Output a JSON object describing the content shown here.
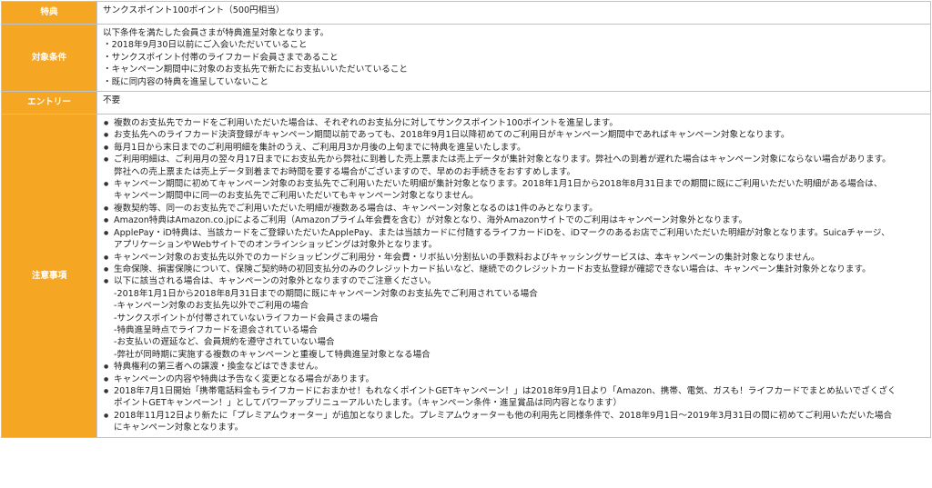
{
  "rows": {
    "benefit": {
      "label": "特典",
      "value": "サンクスポイント100ポイント（500円相当）"
    },
    "conditions": {
      "label": "対象条件",
      "lines": [
        "以下条件を満たした会員さまが特典進呈対象となります。",
        "・2018年9月30日以前にご入会いただいていること",
        "・サンクスポイント付帯のライフカード会員さまであること",
        "・キャンペーン期間中に対象のお支払先で新たにお支払いいただいていること",
        "・既に同内容の特典を進呈していないこと"
      ]
    },
    "entry": {
      "label": "エントリー",
      "value": "不要"
    },
    "notes": {
      "label": "注意事項",
      "items": [
        [
          "複数のお支払先でカードをご利用いただいた場合は、それぞれのお支払分に対してサンクスポイント100ポイントを進呈します。"
        ],
        [
          "お支払先へのライフカード決済登録がキャンペーン期間以前であっても、2018年9月1日以降初めてのご利用日がキャンペーン期間中であればキャンペーン対象となります。"
        ],
        [
          "毎月1日から末日までのご利用明細を集計のうえ、ご利用月3か月後の上旬までに特典を進呈いたします。"
        ],
        [
          "ご利用明細は、ご利用月の翌々月17日までにお支払先から弊社に到着した売上票または売上データが集計対象となります。弊社への到着が遅れた場合はキャンペーン対象にならない場合があります。",
          "弊社への売上票または売上データ到着までお時間を要する場合がございますので、早めのお手続きをおすすめします。"
        ],
        [
          "キャンペーン期間に初めてキャンペーン対象のお支払先でご利用いただいた明細が集計対象となります。2018年1月1日から2018年8月31日までの期間に既にご利用いただいた明細がある場合は、",
          "キャンペーン期間中に同一のお支払先でご利用いただいてもキャンペーン対象となりません。"
        ],
        [
          "複数契約等、同一のお支払先でご利用いただいた明細が複数ある場合は、キャンペーン対象となるのは1件のみとなります。"
        ],
        [
          "Amazon特典はAmazon.co.jpによるご利用（Amazonプライム年会費を含む）が対象となり、海外Amazonサイトでのご利用はキャンペーン対象外となります。"
        ],
        [
          "ApplePay・iD特典は、当該カードをご登録いただいたApplePay、または当該カードに付随するライフカードiDを、iDマークのあるお店でご利用いただいた明細が対象となります。Suicaチャージ、",
          "アプリケーションやWebサイトでのオンラインショッピングは対象外となります。"
        ],
        [
          "キャンペーン対象のお支払先以外でのカードショッピングご利用分・年会費・リボ払い分割払いの手数料およびキャッシングサービスは、本キャンペーンの集計対象となりません。"
        ],
        [
          "生命保険、損害保険について、保険ご契約時の初回支払分のみのクレジットカード払いなど、継続でのクレジットカードお支払登録が確認できない場合は、キャンペーン集計対象外となります。"
        ],
        [
          "以下に該当される場合は、キャンペーンの対象外となりますのでご注意ください。",
          "-2018年1月1日から2018年8月31日までの期間に既にキャンペーン対象のお支払先でご利用されている場合",
          "-キャンペーン対象のお支払先以外でご利用の場合",
          "-サンクスポイントが付帯されていないライフカード会員さまの場合",
          "-特典進呈時点でライフカードを退会されている場合",
          "-お支払いの遅延など、会員規約を遵守されていない場合",
          "-弊社が同時期に実施する複数のキャンペーンと重複して特典進呈対象となる場合"
        ],
        [
          "特典権利の第三者への譲渡・換金などはできません。"
        ],
        [
          "キャンペーンの内容や特典は予告なく変更となる場合があります。"
        ],
        [
          "2018年7月1日開始「携帯電話料金もライフカードにおまかせ！もれなくポイントGETキャンペーン！」は2018年9月1日より「Amazon、携帯、電気、ガスも！ライフカードでまとめ払いでざくざく",
          "ポイントGETキャンペーン！」としてパワーアップリニューアルいたします。（キャンペーン条件・進呈賞品は同内容となります）"
        ],
        [
          "2018年11月12日より新たに「プレミアムウォーター」が追加となりました。プレミアムウォーターも他の利用先と同様条件で、2018年9月1日～2019年3月31日の間に初めてご利用いただいた場合",
          "にキャンペーン対象となります。"
        ]
      ]
    }
  },
  "colors": {
    "label_bg": "#f5a623",
    "label_text": "#ffffff",
    "border": "#c2c2c2"
  }
}
